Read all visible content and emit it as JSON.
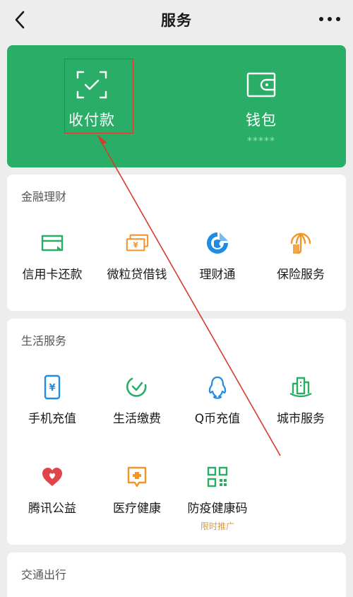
{
  "header": {
    "title": "服务"
  },
  "wallet_card": {
    "background": "#2aae67",
    "pay_label": "收付款",
    "wallet_label": "钱包",
    "wallet_masked_balance": "*****"
  },
  "finance": {
    "title": "金融理财",
    "items": [
      {
        "label": "信用卡还款",
        "icon": "credit-card-icon"
      },
      {
        "label": "微粒贷借钱",
        "icon": "loan-money-icon"
      },
      {
        "label": "理财通",
        "icon": "licaitong-icon"
      },
      {
        "label": "保险服务",
        "icon": "insurance-umbrella-icon"
      }
    ]
  },
  "life": {
    "title": "生活服务",
    "items": [
      {
        "label": "手机充值",
        "icon": "phone-recharge-icon"
      },
      {
        "label": "生活缴费",
        "icon": "utility-payment-icon"
      },
      {
        "label": "Q币充值",
        "icon": "qq-coin-icon"
      },
      {
        "label": "城市服务",
        "icon": "city-service-icon"
      },
      {
        "label": "腾讯公益",
        "icon": "charity-heart-icon"
      },
      {
        "label": "医疗健康",
        "icon": "medical-health-icon"
      },
      {
        "label": "防疫健康码",
        "icon": "health-qr-code-icon",
        "badge": "限时推广"
      }
    ]
  },
  "transport": {
    "title": "交通出行"
  },
  "colors": {
    "green": "#2aae67",
    "blue": "#1e8be6",
    "orange": "#f0962a",
    "red": "#e0454a",
    "annotation_red": "#d93a2b"
  }
}
